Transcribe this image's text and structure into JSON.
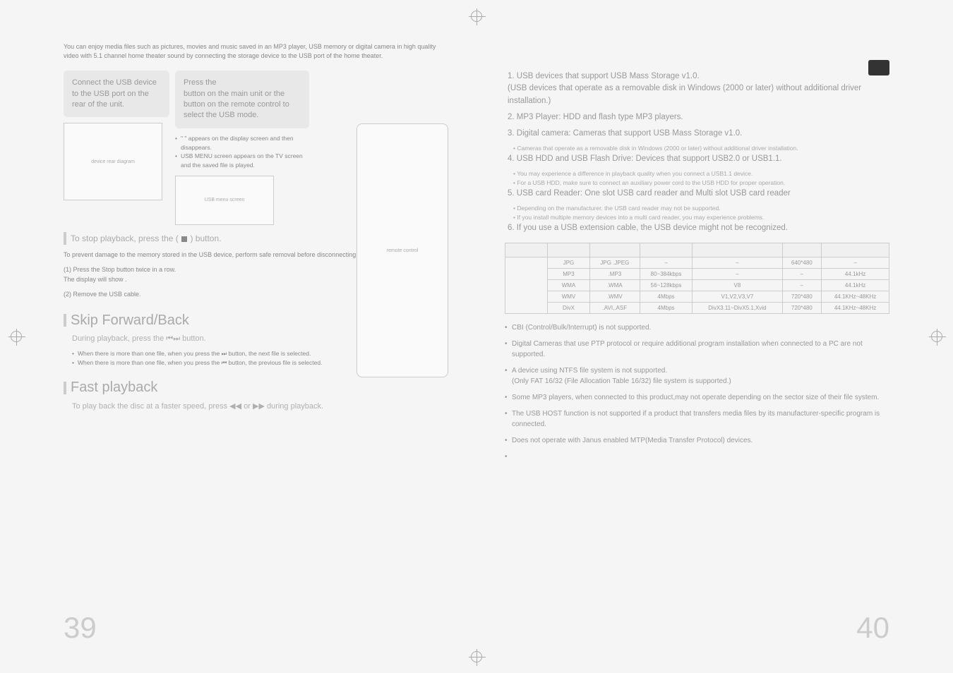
{
  "intro": "You can enjoy media files such as pictures, movies and music saved in an MP3 player, USB memory or digital camera in high quality video with 5.1 channel home theater sound by connecting the storage device to the USB port of the home theater.",
  "step1": "Connect the USB device to the USB port on the rear of the unit.",
  "step2_line1": "Press the",
  "step2_line2": "button on the main unit or the        button on the remote control to select the USB mode.",
  "step2_bullets": [
    "\"     \" appears on the display screen and then disappears.",
    "USB MENU screen appears on the TV screen and the saved file is played."
  ],
  "stop_playback": "To stop playback, press the          (",
  "stop_playback_end": ") button.",
  "safe_removal_intro": "To prevent damage to the memory stored in the USB device, perform safe removal before disconnecting the USB cable.",
  "safe_steps": [
    "(1)  Press the Stop button twice in a row.\n       The display will show                    .",
    "(2) Remove the USB cable."
  ],
  "skip_title": "Skip Forward/Back",
  "skip_sub": "During playback, press the ⏮⏭ button.",
  "skip_bullets": [
    "When there is more than one file, when you press the ⏭ button, the next file is selected.",
    "When there is more than one file, when you press the ⏮ button, the previous file is selected."
  ],
  "fast_title": "Fast playback",
  "fast_sub": "To play back the disc at a faster speed, press ◀◀ or ▶▶ during playback.",
  "page_left": "39",
  "page_right": "40",
  "compat": [
    {
      "main": "1. USB devices that support USB Mass Storage v1.0.\n(USB devices that operate as a removable disk in Windows (2000 or later) without additional driver installation.)",
      "sub": []
    },
    {
      "main": "2. MP3 Player: HDD and flash type MP3 players.",
      "sub": []
    },
    {
      "main": "3. Digital camera: Cameras that support USB Mass Storage v1.0.",
      "sub": [
        "Cameras that operate as a removable disk in Windows (2000 or later) without additional driver installation."
      ]
    },
    {
      "main": "4. USB HDD and USB Flash Drive: Devices that support USB2.0 or USB1.1.",
      "sub": [
        "You may experience a difference in playback quality when you connect a USB1.1 device.",
        "For a USB HDD, make sure to connect an auxiliary power cord to the USB HDD for proper operation."
      ]
    },
    {
      "main": "5. USB card Reader: One slot USB card reader and Multi slot USB card reader",
      "sub": [
        "Depending on the manufacturer. the USB card reader may not be supported.",
        "If you install multiple memory devices into a multi card reader, you may experience problems."
      ]
    },
    {
      "main": "6. If you use a USB extension cable, the USB device might not be recognized.",
      "sub": []
    }
  ],
  "table_rows": [
    {
      "c1": "",
      "c2": "JPG",
      "c3": "JPG .JPEG",
      "c4": "–",
      "c5": "–",
      "c6": "640*480",
      "c7": "–"
    },
    {
      "c1": "",
      "c2": "MP3",
      "c3": ".MP3",
      "c4": "80~384kbps",
      "c5": "–",
      "c6": "–",
      "c7": "44.1kHz"
    },
    {
      "c1": "",
      "c2": "WMA",
      "c3": ".WMA",
      "c4": "56~128kbps",
      "c5": "V8",
      "c6": "–",
      "c7": "44.1kHz"
    },
    {
      "c1": "",
      "c2": "WMV",
      "c3": ".WMV",
      "c4": "4Mbps",
      "c5": "V1,V2,V3,V7",
      "c6": "720*480",
      "c7": "44.1KHz~48KHz"
    },
    {
      "c1": "",
      "c2": "DivX",
      "c3": ".AVI,.ASF",
      "c4": "4Mbps",
      "c5": "DivX3.11~DivX5.1,Xvid",
      "c6": "720*480",
      "c7": "44.1KHz~48KHz"
    }
  ],
  "notes": [
    "CBI (Control/Bulk/Interrupt) is not supported.",
    "Digital Cameras that use PTP protocol or require additional program installation when connected to a PC are not supported.",
    "A device using NTFS file system is not supported.\n(Only FAT 16/32 (File Allocation Table 16/32) file system is supported.)",
    "Some MP3 players, when connected to this product,may not operate depending on the sector size of their file system.",
    "The USB HOST function is not supported if a product that transfers media files by its manufacturer-specific program is connected.",
    "Does not operate with Janus enabled MTP(Media Transfer Protocol) devices."
  ]
}
